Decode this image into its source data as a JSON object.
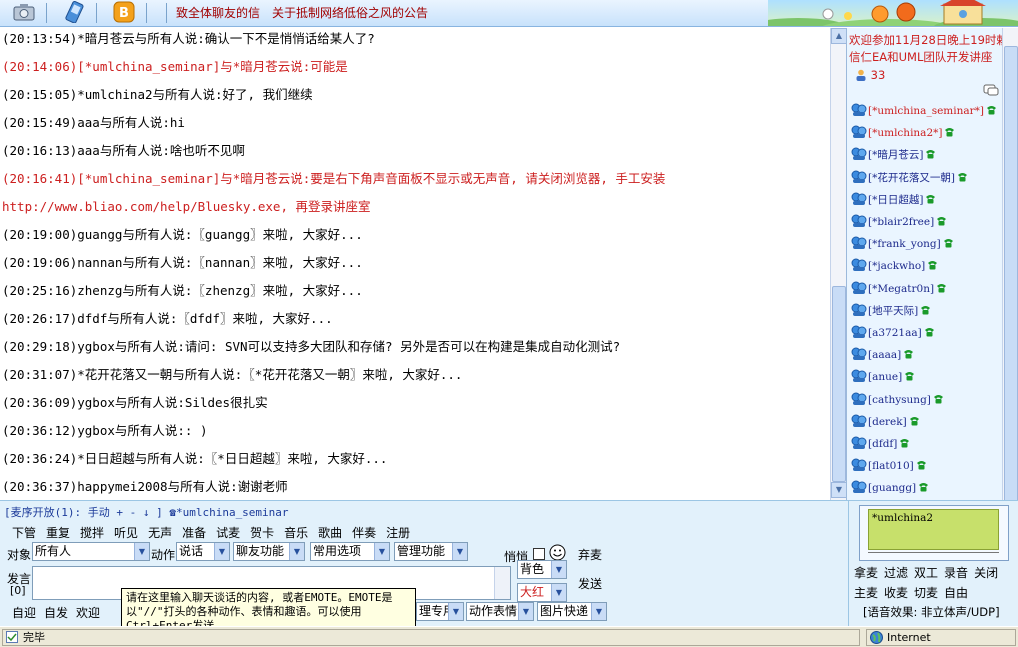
{
  "topbar": {
    "notices": [
      "致全体聊友的信",
      "关于抵制网络低俗之风的公告"
    ],
    "icons": [
      "camera-icon",
      "phone-icon",
      "blog-icon"
    ]
  },
  "chat": {
    "messages": [
      {
        "text": "(20:13:54)*暗月苍云与所有人说:确认一下不是悄悄话给某人了?",
        "color": "black"
      },
      {
        "text": "(20:14:06)[*umlchina_seminar]与*暗月苍云说:可能是",
        "color": "red"
      },
      {
        "text": "(20:15:05)*umlchina2与所有人说:好了, 我们继续",
        "color": "black"
      },
      {
        "text": "(20:15:49)aaa与所有人说:hi",
        "color": "black"
      },
      {
        "text": "(20:16:13)aaa与所有人说:啥也听不见啊",
        "color": "black"
      },
      {
        "text": "(20:16:41)[*umlchina_seminar]与*暗月苍云说:要是右下角声音面板不显示或无声音, 请关闭浏览器, 手工安装",
        "color": "red"
      },
      {
        "text": "http://www.bliao.com/help/Bluesky.exe, 再登录讲座室",
        "color": "red"
      },
      {
        "text": "(20:19:00)guangg与所有人说:〖guangg〗来啦, 大家好...",
        "color": "black"
      },
      {
        "text": "(20:19:06)nannan与所有人说:〖nannan〗来啦, 大家好...",
        "color": "black"
      },
      {
        "text": "(20:25:16)zhenzg与所有人说:〖zhenzg〗来啦, 大家好...",
        "color": "black"
      },
      {
        "text": "(20:26:17)dfdf与所有人说:〖dfdf〗来啦, 大家好...",
        "color": "black"
      },
      {
        "text": "(20:29:18)ygbox与所有人说:请问: SVN可以支持多大团队和存储? 另外是否可以在构建是集成自动化测试?",
        "color": "black"
      },
      {
        "text": "(20:31:07)*花开花落又一朝与所有人说:〖*花开花落又一朝〗来啦, 大家好...",
        "color": "black"
      },
      {
        "text": "(20:36:09)ygbox与所有人说:Sildes很扎实",
        "color": "black"
      },
      {
        "text": "(20:36:12)ygbox与所有人说:: )",
        "color": "black"
      },
      {
        "text": "(20:36:24)*日日超越与所有人说:〖*日日超越〗来啦, 大家好...",
        "color": "black"
      },
      {
        "text": "(20:36:37)happymei2008与所有人说:谢谢老师",
        "color": "black"
      }
    ]
  },
  "right_panel": {
    "announce": "欢迎参加11月28日晚上19时勅信仁EA和UML团队开发讲座",
    "online_count": "33",
    "users": [
      {
        "name": "[*umlchina_seminar*]",
        "red": true
      },
      {
        "name": "[*umlchina2*]",
        "red": true
      },
      {
        "name": "[*暗月苍云]",
        "red": false
      },
      {
        "name": "[*花开花落又一朝]",
        "red": false
      },
      {
        "name": "[*日日超越]",
        "red": false
      },
      {
        "name": "[*blair2free]",
        "red": false
      },
      {
        "name": "[*frank_yong]",
        "red": false
      },
      {
        "name": "[*jackwho]",
        "red": false
      },
      {
        "name": "[*Megatr0n]",
        "red": false
      },
      {
        "name": "[地平天际]",
        "red": false
      },
      {
        "name": "[a3721aa]",
        "red": false
      },
      {
        "name": "[aaaa]",
        "red": false
      },
      {
        "name": "[anue]",
        "red": false
      },
      {
        "name": "[cathysung]",
        "red": false
      },
      {
        "name": "[derek]",
        "red": false
      },
      {
        "name": "[dfdf]",
        "red": false
      },
      {
        "name": "[flat010]",
        "red": false
      },
      {
        "name": "[guangg]",
        "red": false
      }
    ]
  },
  "controls": {
    "queue": "[麦序开放(1): 手动 + - ↓ ] ☎*umlchina_seminar",
    "toolbar1": [
      "下管",
      "重复",
      "搅拌",
      "听见",
      "无声",
      "准备",
      "试麦",
      "贺卡",
      "音乐",
      "歌曲",
      "伴奏",
      "注册"
    ],
    "target_label": "对象",
    "target_value": "所有人",
    "action_label": "动作",
    "action_value": "说话",
    "friend_func": "聊友功能",
    "common_opts": "常用选项",
    "admin_func": "管理功能",
    "whisper_label": "悄悄",
    "give_up_mic": "弃麦",
    "speak_label": "发言",
    "speak_sub": "[0]",
    "bg_color": "背色",
    "text_color": "大红",
    "send_label": "发送",
    "tooltip": "请在这里输入聊天谈话的内容, 或者EMOTE。EMOTE是以\"//\"打头的各种动作、表情和趣语。可以使用Ctrl+Enter发送。",
    "toolbar2": [
      "自迎",
      "自发",
      "欢迎"
    ],
    "sel_dedicated": "理专用",
    "sel_emote": "动作表情",
    "sel_images": "图片快递"
  },
  "right_bottom": {
    "mic_user": "*umlchina2",
    "row1": [
      "拿麦",
      "过滤",
      "双工",
      "录音",
      "关闭"
    ],
    "row2": [
      "主麦",
      "收麦",
      "切麦",
      "自由"
    ],
    "audio_effect": "[语音效果: 非立体声/UDP]"
  },
  "status": {
    "text": "完毕",
    "zone": "Internet"
  }
}
